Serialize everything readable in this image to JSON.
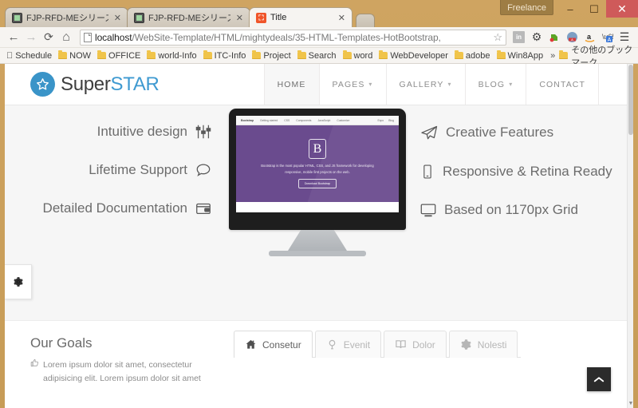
{
  "browser": {
    "profile_label": "Freelance",
    "window_controls": {
      "minimize": "–",
      "maximize": "☐",
      "close": "✕"
    },
    "tabs": [
      {
        "title": "FJP-RFD-MEシリーズ［従来",
        "close": "✕",
        "favicon": "device-icon",
        "active": false
      },
      {
        "title": "FJP-RFD-MEシリーズ［従来",
        "close": "✕",
        "favicon": "device-icon",
        "active": false
      },
      {
        "title": "Title",
        "close": "✕",
        "favicon": "orange-site-icon",
        "active": true
      }
    ],
    "toolbar": {
      "back": "←",
      "forward": "→",
      "reload": "⟳",
      "home": "⌂",
      "url_host": "localhost",
      "url_path": "/WebSite-Template/HTML/mightydeals/35-HTML-Templates-HotBootstrap,",
      "bookmark_star": "☆",
      "extensions": [
        "in",
        "⚙",
        "🗂",
        "pdf",
        "a",
        "文A"
      ],
      "menu": "☰"
    },
    "bookmarks": [
      {
        "label": "Schedule",
        "icon": "apple-icon"
      },
      {
        "label": "NOW",
        "icon": "folder-icon"
      },
      {
        "label": "OFFICE",
        "icon": "folder-icon"
      },
      {
        "label": "world-Info",
        "icon": "folder-icon"
      },
      {
        "label": "ITC-Info",
        "icon": "folder-icon"
      },
      {
        "label": "Project",
        "icon": "folder-icon"
      },
      {
        "label": "Search",
        "icon": "folder-icon"
      },
      {
        "label": "word",
        "icon": "folder-icon"
      },
      {
        "label": "WebDeveloper",
        "icon": "folder-icon"
      },
      {
        "label": "adobe",
        "icon": "folder-icon"
      },
      {
        "label": "Win8App",
        "icon": "folder-icon"
      }
    ],
    "bookmarks_overflow": "»",
    "other_bookmarks": "その他のブックマーク"
  },
  "site": {
    "logo": {
      "part1": "Super",
      "part2": "STAR",
      "mark": "star-icon"
    },
    "nav": [
      {
        "label": "HOME",
        "caret": "",
        "active": true
      },
      {
        "label": "PAGES",
        "caret": "▾",
        "active": false
      },
      {
        "label": "GALLERY",
        "caret": "▾",
        "active": false
      },
      {
        "label": "BLOG",
        "caret": "▾",
        "active": false
      },
      {
        "label": "CONTACT",
        "caret": "",
        "active": false
      }
    ],
    "features_left": [
      {
        "label": "Intuitive design",
        "icon": "sliders-icon"
      },
      {
        "label": "Lifetime Support",
        "icon": "speech-bubble-icon"
      },
      {
        "label": "Detailed Documentation",
        "icon": "wallet-icon"
      }
    ],
    "features_right": [
      {
        "label": "Creative Features",
        "icon": "paper-plane-icon"
      },
      {
        "label": "Responsive & Retina Ready",
        "icon": "mobile-icon"
      },
      {
        "label": "Based on 1170px Grid",
        "icon": "monitor-icon"
      }
    ],
    "imac": {
      "bs_brand": "Bootstrap",
      "bs_nav": [
        "Getting started",
        "CSS",
        "Components",
        "JavaScript",
        "Customize"
      ],
      "bs_nav_right": [
        "Expo",
        "Blog"
      ],
      "bs_logo": "B",
      "bs_tagline": "Bootstrap is the most popular HTML, CSS, and JS framework for developing responsive, mobile first projects on the web.",
      "bs_button": "Download Bootstrap",
      "apple_logo": ""
    },
    "settings_tab_icon": "gear-icon",
    "goals": {
      "title": "Our Goals",
      "icon": "thumbs-up-icon",
      "text": "Lorem ipsum dolor sit amet, consectetur adipisicing elit. Lorem ipsum dolor sit amet"
    },
    "content_tabs": [
      {
        "label": "Consetur",
        "icon": "home-icon",
        "active": true
      },
      {
        "label": "Evenit",
        "icon": "lightbulb-icon",
        "active": false
      },
      {
        "label": "Dolor",
        "icon": "book-icon",
        "active": false
      },
      {
        "label": "Nolesti",
        "icon": "gear-icon",
        "active": false
      }
    ],
    "scroll_top": {
      "icon": "chevron-up-icon"
    }
  },
  "colors": {
    "window_frame": "#c79c57",
    "accent_blue": "#3f9ad1",
    "hero_bg": "#f6f6f6",
    "bootstrap_purple": "#6a4b8e",
    "scroll_top_bg": "#2b2b2b",
    "close_button": "#cf5a5a"
  }
}
